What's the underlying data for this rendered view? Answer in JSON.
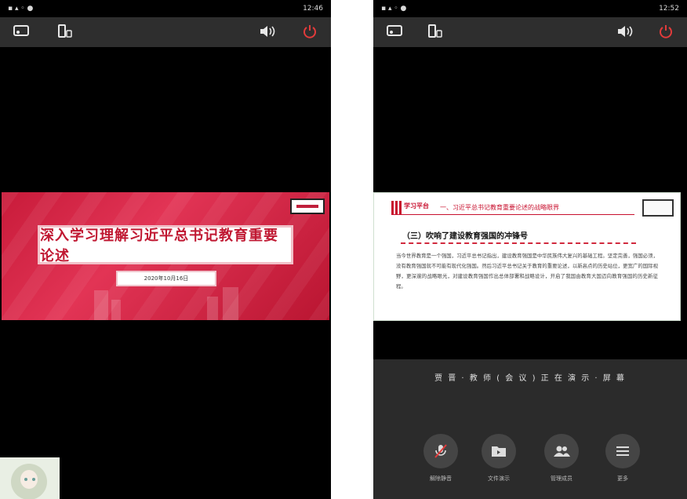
{
  "status_bar": {
    "left_time": "12:46",
    "right_time": "12:52"
  },
  "toolbar": {
    "icons": [
      "screen-cast-icon",
      "phone-icon",
      "speaker-icon",
      "power-icon"
    ],
    "power_color": "#e23b3b"
  },
  "left_slide": {
    "title": "深入学习理解习近平总书记教育重要论述",
    "date": "2020年10月16日"
  },
  "right_slide": {
    "logo_text": "学习平台",
    "section_header": "一、习近平总书记教育重要论述的战略眼界",
    "subheading": "（三）吹响了建设教育强国的冲锋号",
    "paragraph": "当今世界教育是一个强国，习近平总书记指出，建设教育强国是中华民族伟大复兴的基础工程。坚定完善，强国必须，没有教育强国就不可能有现代化强国。然后习近平总书记关于教育的重要论述，以新高点的历史站位，更宽广的国际视野，更深邃的战略眼光，对建设教育强国作出总体部署和战略设计，开启了我国由教育大国迈向教育强国的历史新征程。"
  },
  "presenting_text": "贾 晋 · 教 师 ( 会 议 ) 正 在 演 示 · 屏 幕",
  "controls": [
    {
      "label": "解除静音",
      "icon": "mic-muted-icon"
    },
    {
      "label": "文件演示",
      "icon": "folder-icon"
    },
    {
      "label": "管理成员",
      "icon": "members-icon"
    },
    {
      "label": "更多",
      "icon": "menu-icon"
    }
  ]
}
